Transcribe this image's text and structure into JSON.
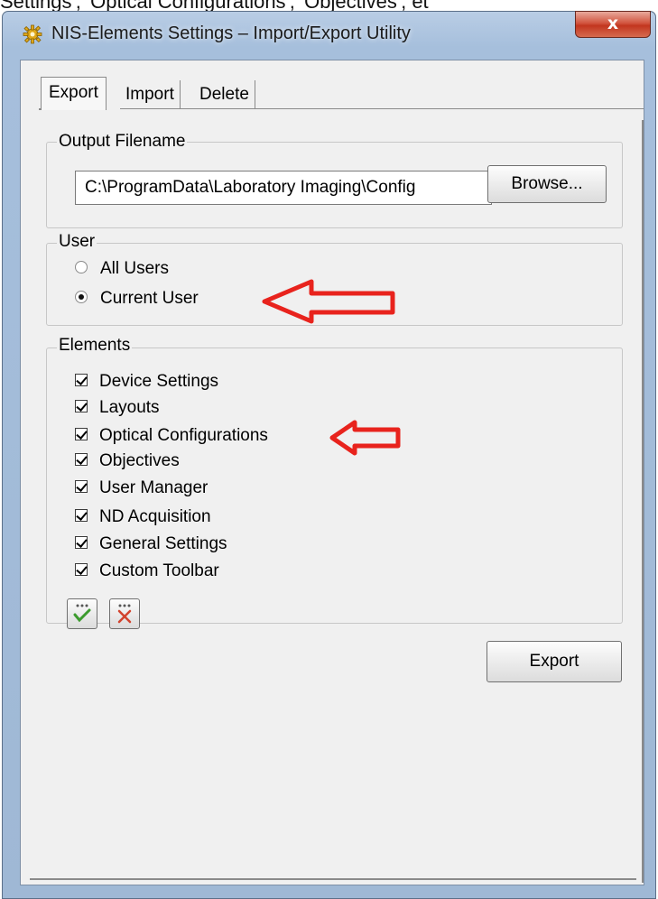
{
  "caption_text": "Settings', 'Optical Configurations', 'Objectives', et",
  "window": {
    "title": "NIS-Elements Settings – Import/Export Utility",
    "close_label": "x"
  },
  "tabs": [
    {
      "label": "Export",
      "selected": true
    },
    {
      "label": "Import",
      "selected": false
    },
    {
      "label": "Delete",
      "selected": false
    }
  ],
  "output": {
    "legend": "Output Filename",
    "path": "C:\\ProgramData\\Laboratory Imaging\\Config",
    "browse_label": "Browse..."
  },
  "user": {
    "legend": "User",
    "options": [
      {
        "label": "All Users",
        "selected": false
      },
      {
        "label": "Current User",
        "selected": true
      }
    ]
  },
  "elements": {
    "legend": "Elements",
    "items": [
      {
        "label": "Device Settings",
        "checked": true
      },
      {
        "label": "Layouts",
        "checked": true
      },
      {
        "label": "Optical Configurations",
        "checked": true
      },
      {
        "label": "Objectives",
        "checked": true
      },
      {
        "label": "User Manager",
        "checked": true
      },
      {
        "label": "ND Acquisition",
        "checked": true
      },
      {
        "label": "General Settings",
        "checked": true
      },
      {
        "label": "Custom Toolbar",
        "checked": true
      }
    ],
    "check_all_icon": "check-all-icon",
    "uncheck_all_icon": "uncheck-all-icon"
  },
  "export_label": "Export",
  "colors": {
    "annotation_arrow": "#e8231d",
    "close_button": "#c7432a",
    "frame": "#a6bfdc"
  }
}
